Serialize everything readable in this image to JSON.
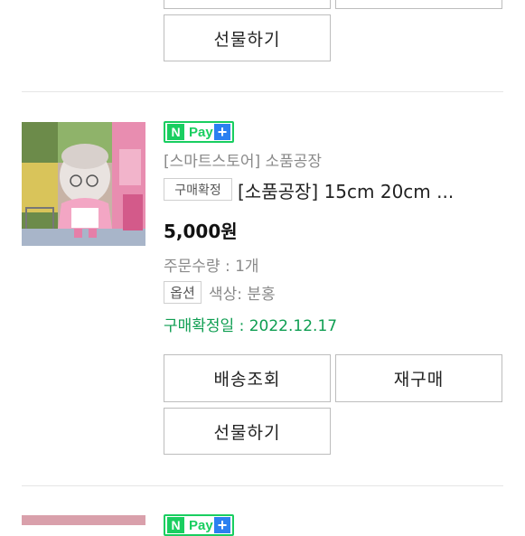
{
  "top_item": {
    "gift_button": "선물하기"
  },
  "order": {
    "pay_badge": {
      "n": "N",
      "pay": "Pay",
      "plus": "+"
    },
    "store": "[스마트스토어] 소품공장",
    "status_tag": "구매확정",
    "title": "[소품공장] 15cm 20cm ...",
    "price": "5,000원",
    "quantity": "주문수량 : 1개",
    "option_tag": "옵션",
    "option_value": "색상: 분홍",
    "confirm_date": "구매확정일 : 2022.12.17",
    "buttons": {
      "track": "배송조회",
      "reorder": "재구매",
      "gift": "선물하기"
    }
  },
  "next_item": {
    "pay_badge": {
      "n": "N",
      "pay": "Pay",
      "plus": "+"
    }
  },
  "colors": {
    "green": "#19ce60",
    "date_green": "#0f9e52",
    "plus_blue": "#2b80f0",
    "muted": "#888888"
  }
}
